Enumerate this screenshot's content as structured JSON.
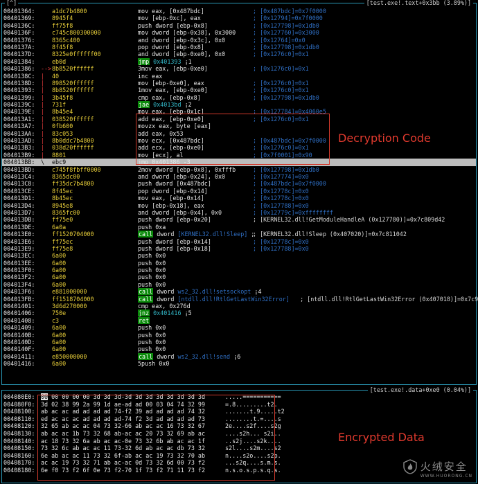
{
  "top_pane": {
    "corner_tag": "[^]",
    "title": "[test.exe!.text+0x3bb (3.89%)]",
    "rows": [
      {
        "addr": "00401364:",
        "arrow": "",
        "bytes": "a1dc7b4800",
        "ins": [
          {
            "t": "mov eax, [0x487bdc]",
            "c": "m"
          }
        ],
        "cmt": "; [0x487bdc]=0x7f0000",
        "cw": false
      },
      {
        "addr": "00401369:",
        "arrow": "",
        "bytes": "8945f4",
        "ins": [
          {
            "t": "mov [ebp-0xc], eax",
            "c": "m"
          }
        ],
        "cmt": "; [0x12794]=0x7f0000",
        "cw": false
      },
      {
        "addr": "0040136C:",
        "arrow": "",
        "bytes": "ff75f8",
        "ins": [
          {
            "t": "push dword [ebp-0x8]",
            "c": "m"
          }
        ],
        "cmt": "; [0x127798]=0x1db0",
        "cw": false
      },
      {
        "addr": "0040136F:",
        "arrow": "",
        "bytes": "c745c800300000",
        "ins": [
          {
            "t": "mov dword [ebp-0x38], 0x3000",
            "c": "m"
          }
        ],
        "cmt": "; [0x127760]=0x3000",
        "cw": false
      },
      {
        "addr": "00401376:",
        "arrow": "",
        "bytes": "8365c400",
        "ins": [
          {
            "t": "and dword [ebp-0x3c], 0x0",
            "c": "m"
          }
        ],
        "cmt": "; [0x12764]=0x0",
        "cw": false
      },
      {
        "addr": "0040137A:",
        "arrow": "",
        "bytes": "8f45f8",
        "ins": [
          {
            "t": "pop dword [ebp-0x8]",
            "c": "m"
          }
        ],
        "cmt": "; [0x127798]=0x1db0",
        "cw": false
      },
      {
        "addr": "0040137D:",
        "arrow": "",
        "bytes": "8325e0ffffff00",
        "ins": [
          {
            "t": "and dword [ebp-0xe0], 0x0",
            "c": "m"
          }
        ],
        "cmt": "; [0x1276c0]=0x1",
        "cw": false
      },
      {
        "addr": "00401384:",
        "arrow": "",
        "bytes": "eb0d",
        "ins": [
          {
            "t": "jmp",
            "c": "g"
          },
          {
            "t": " 0x401393 ",
            "c": "h"
          },
          {
            "t": "¡1",
            "c": "m"
          }
        ],
        "cmt": "",
        "cw": false
      },
      {
        "addr": "00401386:",
        "arrow": "-->",
        "bytes": "8b8520ffffff",
        "ins": [
          {
            "t": "3mov eax, [ebp-0xe0]",
            "c": "m"
          }
        ],
        "cmt": "; [0x1276c0]=0x1",
        "cw": false
      },
      {
        "addr": "0040138C:",
        "arrow": "|",
        "bytes": "40",
        "ins": [
          {
            "t": "inc eax",
            "c": "m"
          }
        ],
        "cmt": "",
        "cw": false
      },
      {
        "addr": "0040138D:",
        "arrow": "|",
        "bytes": "898520ffffff",
        "ins": [
          {
            "t": "mov [ebp-0xe0], eax",
            "c": "m"
          }
        ],
        "cmt": "; [0x1276c0]=0x1",
        "cw": false
      },
      {
        "addr": "00401393:",
        "arrow": "|",
        "bytes": "8b8520ffffff",
        "ins": [
          {
            "t": "1mov eax, [ebp-0xe0]",
            "c": "m"
          }
        ],
        "cmt": "; [0x1276c0]=0x1",
        "cw": false
      },
      {
        "addr": "00401399:",
        "arrow": "|",
        "bytes": "3b45f8",
        "ins": [
          {
            "t": "cmp eax, [ebp-0x8]",
            "c": "m"
          }
        ],
        "cmt": "; [0x127798]=0x1db0",
        "cw": false
      },
      {
        "addr": "0040139C:",
        "arrow": "|",
        "bytes": "731f",
        "ins": [
          {
            "t": "jae",
            "c": "g"
          },
          {
            "t": " 0x4013bd ",
            "c": "h"
          },
          {
            "t": "¡2",
            "c": "m"
          }
        ],
        "cmt": "",
        "cw": false
      },
      {
        "addr": "0040139E:",
        "arrow": "|",
        "bytes": "8b45e4",
        "ins": [
          {
            "t": "mov eax, [ebp-0x1c]",
            "c": "m"
          }
        ],
        "cmt": "; [0x127784]=0x4060e5",
        "cw": false
      },
      {
        "addr": "004013A1:",
        "arrow": "|",
        "bytes": "038520ffffff",
        "ins": [
          {
            "t": "add eax, [ebp-0xe0]",
            "c": "m"
          }
        ],
        "cmt": "; [0x1276c0]=0x1",
        "cw": false
      },
      {
        "addr": "004013A7:",
        "arrow": "|",
        "bytes": "0fb600",
        "ins": [
          {
            "t": "movzx eax, byte [eax]",
            "c": "m"
          }
        ],
        "cmt": "",
        "cw": false
      },
      {
        "addr": "004013AA:",
        "arrow": "|",
        "bytes": "83c053",
        "ins": [
          {
            "t": "add eax, 0x53",
            "c": "m"
          }
        ],
        "cmt": "",
        "cw": false
      },
      {
        "addr": "004013AD:",
        "arrow": "|",
        "bytes": "8b0ddc7b4800",
        "ins": [
          {
            "t": "mov ecx, [0x487bdc]",
            "c": "m"
          }
        ],
        "cmt": "; [0x487bdc]=0x7f0000",
        "cw": false
      },
      {
        "addr": "004013B3:",
        "arrow": "|",
        "bytes": "038d20ffffff",
        "ins": [
          {
            "t": "add ecx, [ebp-0xe0]",
            "c": "m"
          }
        ],
        "cmt": "; [0x1276c0]=0x1",
        "cw": false
      },
      {
        "addr": "004013B9:",
        "arrow": "|",
        "bytes": "8801",
        "ins": [
          {
            "t": "mov [ecx], al",
            "c": "m"
          }
        ],
        "cmt": "; [0x7f0001]=0x90",
        "cw": false
      },
      {
        "addr": "004013BB:",
        "arrow": "\\",
        "bytes": "ebc9",
        "ins": [
          {
            "t": "jmp 0x401386 ",
            "c": "m"
          },
          {
            "t": "-3",
            "c": "m"
          }
        ],
        "cmt": "",
        "cw": false,
        "hl": true
      },
      {
        "addr": "004013BD:",
        "arrow": "",
        "bytes": "c745f8fbff0000",
        "ins": [
          {
            "t": "2mov dword [ebp-0x8], 0xfffb",
            "c": "m"
          }
        ],
        "cmt": "; [0x127798]=0x1db0",
        "cw": false
      },
      {
        "addr": "004013C4:",
        "arrow": "",
        "bytes": "8365dc00",
        "ins": [
          {
            "t": "and dword [ebp-0x24], 0x0",
            "c": "m"
          }
        ],
        "cmt": "; [0x127774]=0x0",
        "cw": false
      },
      {
        "addr": "004013C8:",
        "arrow": "",
        "bytes": "ff35dc7b4800",
        "ins": [
          {
            "t": "push dword [0x487bdc]",
            "c": "m"
          }
        ],
        "cmt": "; [0x487bdc]=0x7f0000",
        "cw": false
      },
      {
        "addr": "004013CE:",
        "arrow": "",
        "bytes": "8f45ec",
        "ins": [
          {
            "t": "pop dword [ebp-0x14]",
            "c": "m"
          }
        ],
        "cmt": "; [0x12778c]=0x0",
        "cw": false
      },
      {
        "addr": "004013D1:",
        "arrow": "",
        "bytes": "8b45ec",
        "ins": [
          {
            "t": "mov eax, [ebp-0x14]",
            "c": "m"
          }
        ],
        "cmt": "; [0x12778c]=0x0",
        "cw": false
      },
      {
        "addr": "004013D4:",
        "arrow": "",
        "bytes": "8945e8",
        "ins": [
          {
            "t": "mov [ebp-0x18], eax",
            "c": "m"
          }
        ],
        "cmt": "; [0x127788]=0x0",
        "cw": false
      },
      {
        "addr": "004013D7:",
        "arrow": "",
        "bytes": "8365fc00",
        "ins": [
          {
            "t": "and dword [ebp-0x4], 0x0",
            "c": "m"
          }
        ],
        "cmt": "; [0x12779c]=0xffffffff",
        "cw": false
      },
      {
        "addr": "004013DB:",
        "arrow": "",
        "bytes": "ff75e0",
        "ins": [
          {
            "t": "push dword [ebp-0x20]",
            "c": "m"
          }
        ],
        "cmt": "; [KERNEL32.dll!GetModuleHandleA (0x127780)]=0x7c809d42",
        "cw": true
      },
      {
        "addr": "004013DE:",
        "arrow": "",
        "bytes": "6a0a",
        "ins": [
          {
            "t": "push 0xa",
            "c": "m"
          }
        ],
        "cmt": "",
        "cw": false
      },
      {
        "addr": "004013E0:",
        "arrow": "",
        "bytes": "ff1520704000",
        "ins": [
          {
            "t": "call",
            "c": "g"
          },
          {
            "t": " dword ",
            "c": "m"
          },
          {
            "t": "[KERNEL32.dll!Sleep]",
            "c": "sym"
          },
          {
            "t": " ;",
            "c": "m"
          }
        ],
        "cmt": "; [KERNEL32.dll!Sleep (0x407020)]=0x7c811042",
        "cw": true
      },
      {
        "addr": "004013E6:",
        "arrow": "",
        "bytes": "ff75ec",
        "ins": [
          {
            "t": "push dword [ebp-0x14]",
            "c": "m"
          }
        ],
        "cmt": "; [0x12778c]=0x0",
        "cw": false
      },
      {
        "addr": "004013E9:",
        "arrow": "",
        "bytes": "ff75e8",
        "ins": [
          {
            "t": "push dword [ebp-0x18]",
            "c": "m"
          }
        ],
        "cmt": "; [0x127788]=0x0",
        "cw": false
      },
      {
        "addr": "004013EC:",
        "arrow": "",
        "bytes": "6a00",
        "ins": [
          {
            "t": "push 0x0",
            "c": "m"
          }
        ],
        "cmt": "",
        "cw": false
      },
      {
        "addr": "004013EE:",
        "arrow": "",
        "bytes": "6a00",
        "ins": [
          {
            "t": "push 0x0",
            "c": "m"
          }
        ],
        "cmt": "",
        "cw": false
      },
      {
        "addr": "004013F0:",
        "arrow": "",
        "bytes": "6a00",
        "ins": [
          {
            "t": "push 0x0",
            "c": "m"
          }
        ],
        "cmt": "",
        "cw": false
      },
      {
        "addr": "004013F2:",
        "arrow": "",
        "bytes": "6a00",
        "ins": [
          {
            "t": "push 0x0",
            "c": "m"
          }
        ],
        "cmt": "",
        "cw": false
      },
      {
        "addr": "004013F4:",
        "arrow": "",
        "bytes": "6a00",
        "ins": [
          {
            "t": "push 0x0",
            "c": "m"
          }
        ],
        "cmt": "",
        "cw": false
      },
      {
        "addr": "004013F6:",
        "arrow": "",
        "bytes": "e881000000",
        "ins": [
          {
            "t": "call",
            "c": "g"
          },
          {
            "t": " dword ",
            "c": "m"
          },
          {
            "t": "ws2_32.dll!setsockopt",
            "c": "sym"
          },
          {
            "t": " ¡4",
            "c": "m"
          }
        ],
        "cmt": "",
        "cw": false
      },
      {
        "addr": "004013FB:",
        "arrow": "",
        "bytes": "ff1518704000",
        "ins": [
          {
            "t": "call",
            "c": "g"
          },
          {
            "t": " dword ",
            "c": "m"
          },
          {
            "t": "[ntdll.dll!RtlGetLastWin32Error]",
            "c": "sym"
          }
        ],
        "cmt": "  ; [ntdll.dll!RtlGetLastWin32Error (0x407018)]=0x7c9",
        "cw": true,
        "wide": true
      },
      {
        "addr": "00401401:",
        "arrow": "",
        "bytes": "3d6d270000",
        "ins": [
          {
            "t": "cmp eax, 0x276d",
            "c": "m"
          }
        ],
        "cmt": "",
        "cw": false
      },
      {
        "addr": "00401406:",
        "arrow": "",
        "bytes": "750e",
        "ins": [
          {
            "t": "jnz",
            "c": "g"
          },
          {
            "t": " 0x401416 ",
            "c": "h"
          },
          {
            "t": "¡5",
            "c": "m"
          }
        ],
        "cmt": "",
        "cw": false
      },
      {
        "addr": "00401408:",
        "arrow": "",
        "bytes": "c3",
        "ins": [
          {
            "t": "ret",
            "c": "g"
          }
        ],
        "cmt": "",
        "cw": false
      },
      {
        "addr": "00401409:",
        "arrow": "",
        "bytes": "6a00",
        "ins": [
          {
            "t": "push 0x0",
            "c": "m"
          }
        ],
        "cmt": "",
        "cw": false
      },
      {
        "addr": "0040140B:",
        "arrow": "",
        "bytes": "6a00",
        "ins": [
          {
            "t": "push 0x0",
            "c": "m"
          }
        ],
        "cmt": "",
        "cw": false
      },
      {
        "addr": "0040140D:",
        "arrow": "",
        "bytes": "6a00",
        "ins": [
          {
            "t": "push 0x0",
            "c": "m"
          }
        ],
        "cmt": "",
        "cw": false
      },
      {
        "addr": "0040140F:",
        "arrow": "",
        "bytes": "6a00",
        "ins": [
          {
            "t": "push 0x0",
            "c": "m"
          }
        ],
        "cmt": "",
        "cw": false
      },
      {
        "addr": "00401411:",
        "arrow": "",
        "bytes": "e850000000",
        "ins": [
          {
            "t": "call",
            "c": "g"
          },
          {
            "t": " dword ",
            "c": "m"
          },
          {
            "t": "ws2_32.dll!send",
            "c": "sym"
          },
          {
            "t": " ¡6",
            "c": "m"
          }
        ],
        "cmt": "",
        "cw": false
      },
      {
        "addr": "00401416:",
        "arrow": "",
        "bytes": "6a00",
        "ins": [
          {
            "t": "5push 0x0",
            "c": "m"
          }
        ],
        "cmt": "",
        "cw": false
      }
    ]
  },
  "bottom_pane": {
    "title": "[test.exe!.data+0xe0 (0.04%)]",
    "rows": [
      {
        "addr": "004080E0:",
        "hex": "00 00 00 00 00 3d 3d 3d-3d 3d 3d 3d 3d 3d 3d 3d",
        "ascii": ".....===========",
        "cursor": true
      },
      {
        "addr": "004080F0:",
        "hex": "3d 02 38 99 2a 99 1d ae-ad ad 00 03 04 74 32 99",
        "ascii": "=.8.........t2.",
        "cursor": false
      },
      {
        "addr": "00408100:",
        "hex": "ab ac ac ad ad ad ad 74-f2 39 ad ad ad ad 74 32",
        "ascii": ".......t.9.....t2",
        "cursor": false
      },
      {
        "addr": "00408110:",
        "hex": "ed ac ac ac ad ad ad ad-74 f2 3d ad ad ad ad 73",
        "ascii": "........t.=....s",
        "cursor": false
      },
      {
        "addr": "00408120:",
        "hex": "32 65 ab ac ac 04 73 32-66 ab ac ac 16 73 32 67",
        "ascii": "2e....s2f....s2g",
        "cursor": false
      },
      {
        "addr": "00408130:",
        "hex": "ab ac ac 1b 73 32 68 ab-ac ac 20 73 32 69 ab ac",
        "ascii": "....s2h... s2i..",
        "cursor": false
      },
      {
        "addr": "00408140:",
        "hex": "ac 18 73 32 6a ab ac ac-0e 73 32 6b ab ac ac 1f",
        "ascii": "..s2j....s2k....",
        "cursor": false
      },
      {
        "addr": "00408150:",
        "hex": "73 32 6c ab ac ac 11 73-32 6d ab ac ac db 73 32",
        "ascii": "s2l....s2m....s2",
        "cursor": false
      },
      {
        "addr": "00408160:",
        "hex": "6e ab ac ac 11 73 32 6f-ab ac ac 19 73 32 70 ab",
        "ascii": "n....s2o....s2p.",
        "cursor": false
      },
      {
        "addr": "00408170:",
        "hex": "ac ac 19 73 32 71 ab ac-ac 0d 73 32 6d 00 73 f2",
        "ascii": "...s2q....s.m.s.",
        "cursor": false
      },
      {
        "addr": "00408180:",
        "hex": "6e f0 73 f2 6f 0e 73 f2-70 1f 73 f2 71 11 73 f2",
        "ascii": "n.s.o.s.p.s.q.s.",
        "cursor": false
      }
    ]
  },
  "annotations": {
    "decryption_label": "Decryption Code",
    "encrypted_label": "Encrypted Data",
    "accent_color": "#e23a2e",
    "frame_color": "#2a9ab8"
  },
  "watermark": {
    "cn": "火绒安全",
    "url": "WWW.HUORONG.CN",
    "logo_icon": "flame-shield-icon"
  }
}
